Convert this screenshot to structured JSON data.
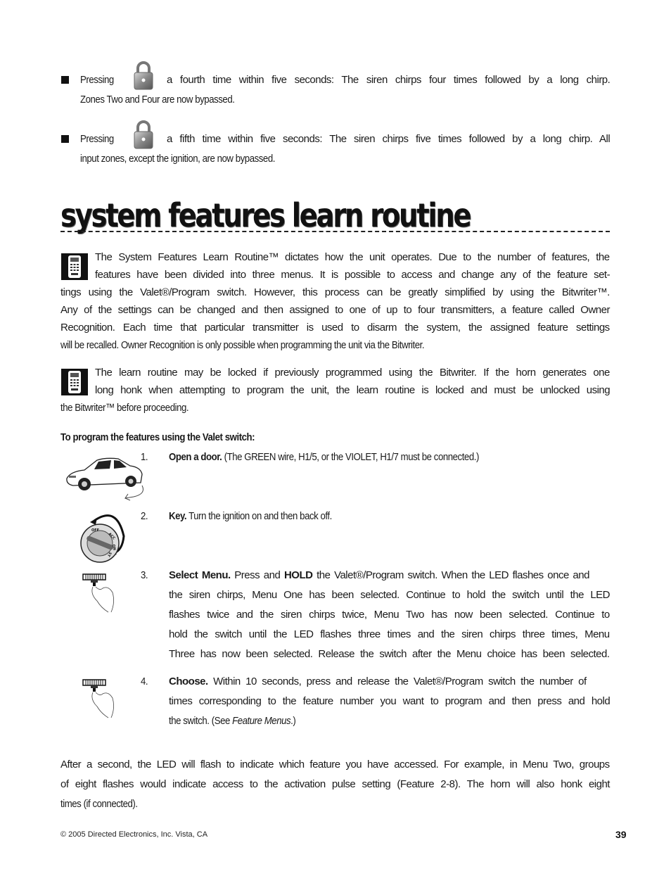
{
  "bullets": [
    {
      "prefix": "Pressing",
      "icon": "lock-icon",
      "line1": "a fourth time within five seconds: The siren chirps four times followed by a long chirp.",
      "line2": "Zones Two and Four are now bypassed."
    },
    {
      "prefix": "Pressing",
      "icon": "lock-icon",
      "line1": "a fifth time within five seconds: The siren chirps five times followed by a long chirp. All",
      "line2": "input zones, except the ignition, are now bypassed."
    }
  ],
  "section": {
    "heading": "system features learn routine"
  },
  "intro": {
    "icon": "bitwriter-icon",
    "lines": [
      "The System Features Learn Routine™ dictates how the unit operates. Due to the number of features, the",
      "features have been divided into three menus. It is possible to access and change any of the feature set-",
      "tings using the Valet®/Program switch. However, this process can be greatly simplified by using the Bitwriter™.",
      "Any of the settings can be changed and then assigned to one of up to four transmitters, a feature called Owner",
      "Recognition. Each time that particular transmitter is used to disarm the system, the assigned feature settings",
      "will be recalled. Owner Recognition is only possible when programming the unit via the Bitwriter."
    ]
  },
  "lock_note": {
    "icon": "bitwriter-icon",
    "lines": [
      "The learn routine may be locked if previously programmed using the Bitwriter. If the horn generates one",
      "long honk when attempting to program the unit, the learn routine is locked and must be unlocked using",
      "the Bitwriter™ before proceeding."
    ]
  },
  "subheading": "To program the features using the Valet switch:",
  "steps": [
    {
      "number": "1.",
      "icon": "car-door-icon",
      "title": "Open a door.",
      "lines": [
        "(The GREEN wire, H1/5, or the VIOLET, H1/7 must be connected.)"
      ]
    },
    {
      "number": "2.",
      "icon": "ignition-key-icon",
      "title": "Key.",
      "lines": [
        "Turn the ignition on and then back off."
      ],
      "icon_labels": [
        "OFF",
        "ACC",
        "ON",
        "ST"
      ]
    },
    {
      "number": "3.",
      "icon": "valet-switch-press-icon",
      "title": "Select Menu.",
      "line1_pre": "Press and",
      "line1_bold": "HOLD",
      "line1_post": "the Valet®/Program switch. When the LED flashes once and",
      "lines": [
        "the siren chirps, Menu One has been selected. Continue to hold the switch until the LED",
        "flashes twice and the siren chirps twice, Menu Two has now been selected. Continue to",
        "hold the switch until the LED flashes three times and the siren chirps three times, Menu",
        "Three has now been selected. Release the switch after the Menu choice has been selected."
      ]
    },
    {
      "number": "4.",
      "icon": "valet-switch-press-icon",
      "title": "Choose.",
      "line1": "Within 10 seconds, press and release the Valet®/Program switch the number of",
      "line2": "times corresponding to the feature number you want to program and then press and hold",
      "line3_pre": "the switch. (See",
      "line3_ital": "Feature Menus",
      "line3_post": ".)"
    }
  ],
  "closing": {
    "lines": [
      "After a second, the LED will flash to indicate which feature you have accessed. For example, in Menu Two, groups",
      "of eight flashes would indicate access to the activation pulse setting (Feature 2-8). The horn will also honk eight",
      "times (if connected)."
    ]
  },
  "footer": {
    "copyright": "© 2005 Directed Electronics, Inc. Vista, CA",
    "page_number": "39"
  }
}
